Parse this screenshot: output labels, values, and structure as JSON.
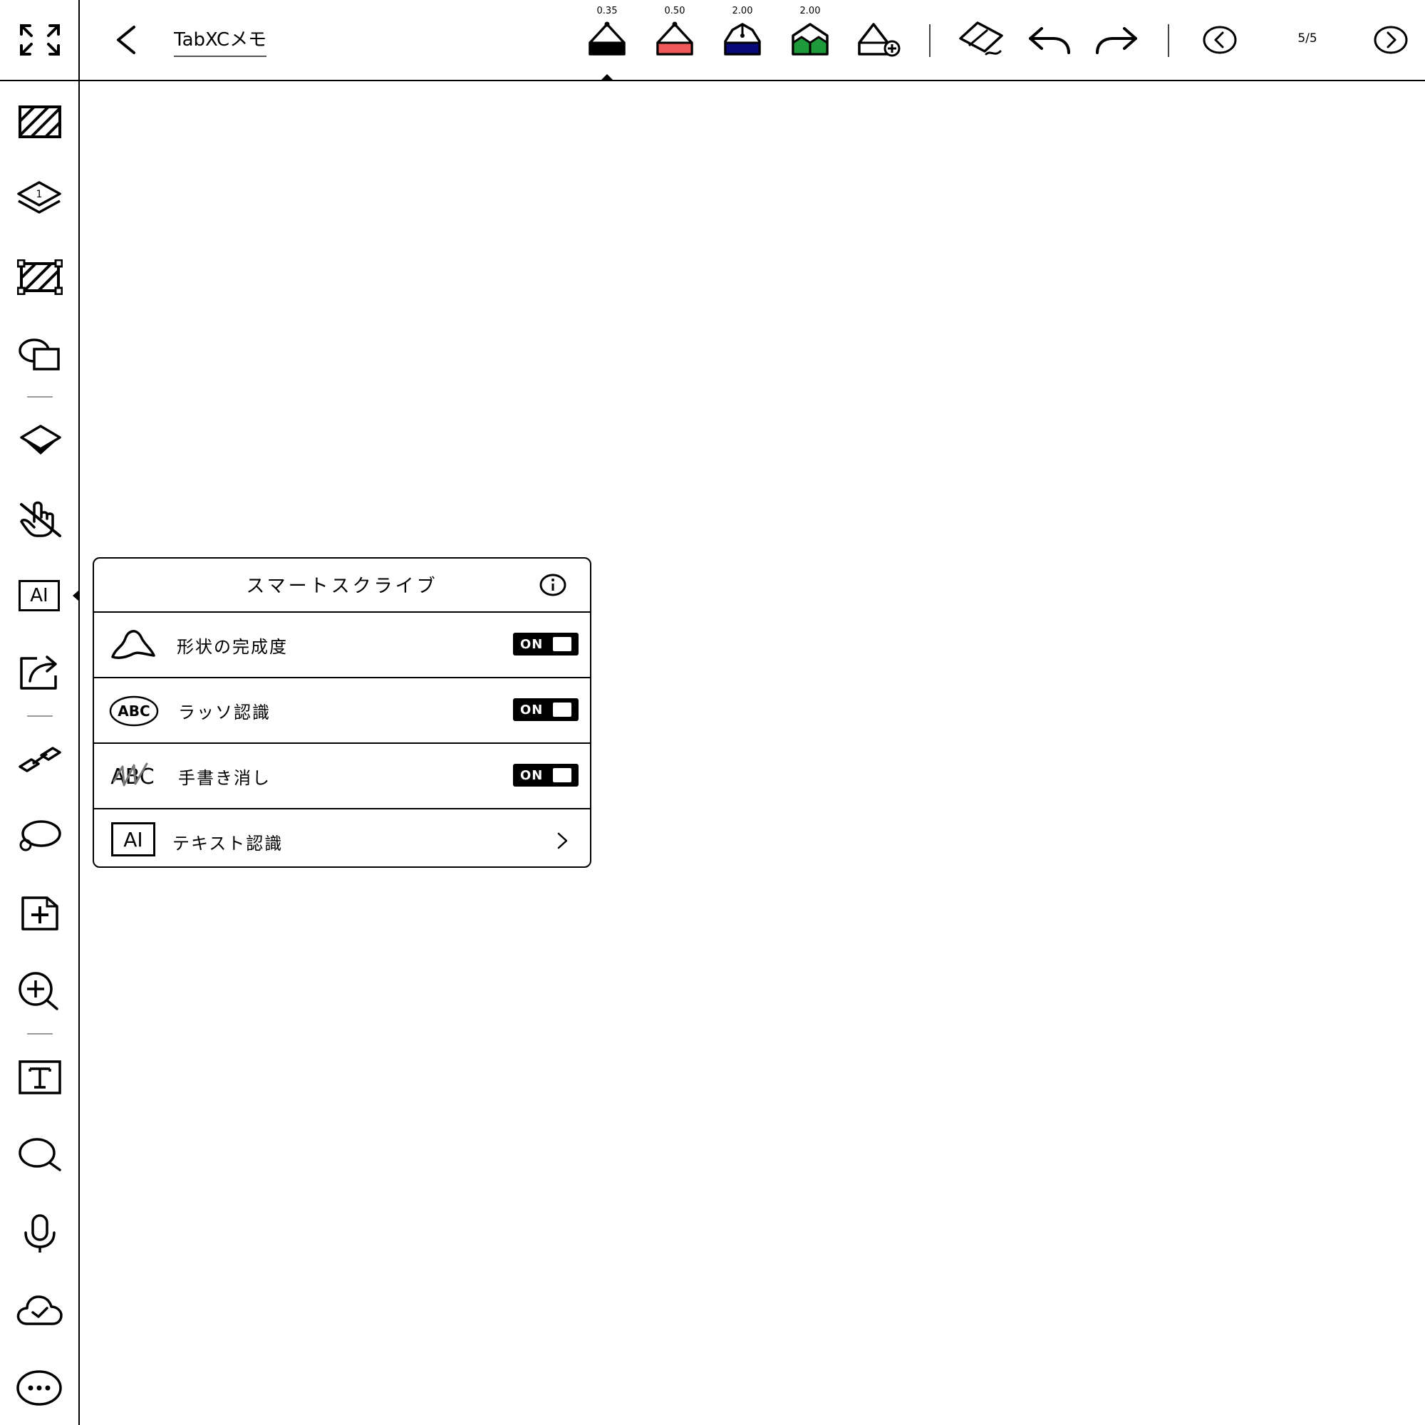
{
  "header": {
    "title": "TabXCメモ",
    "page_indicator": "5/5"
  },
  "pens": [
    {
      "size": "0.35",
      "color": "#000000"
    },
    {
      "size": "0.50",
      "color": "#f05a5a"
    },
    {
      "size": "2.00",
      "color": "#0a0a7a"
    },
    {
      "size": "2.00",
      "color": "#1f9a3a"
    }
  ],
  "smart_scribe": {
    "title": "スマートスクライブ",
    "rows": [
      {
        "label": "形状の完成度",
        "toggle": "ON"
      },
      {
        "label": "ラッソ認識",
        "toggle": "ON"
      },
      {
        "label": "手書き消し",
        "toggle": "ON"
      },
      {
        "label": "テキスト認識"
      }
    ],
    "icon_text": {
      "lasso_abc": "ABC",
      "erase_abc": "ABC",
      "ai": "AI"
    }
  },
  "sidebar": {
    "ai_label": "AI",
    "layer_number": "1"
  }
}
